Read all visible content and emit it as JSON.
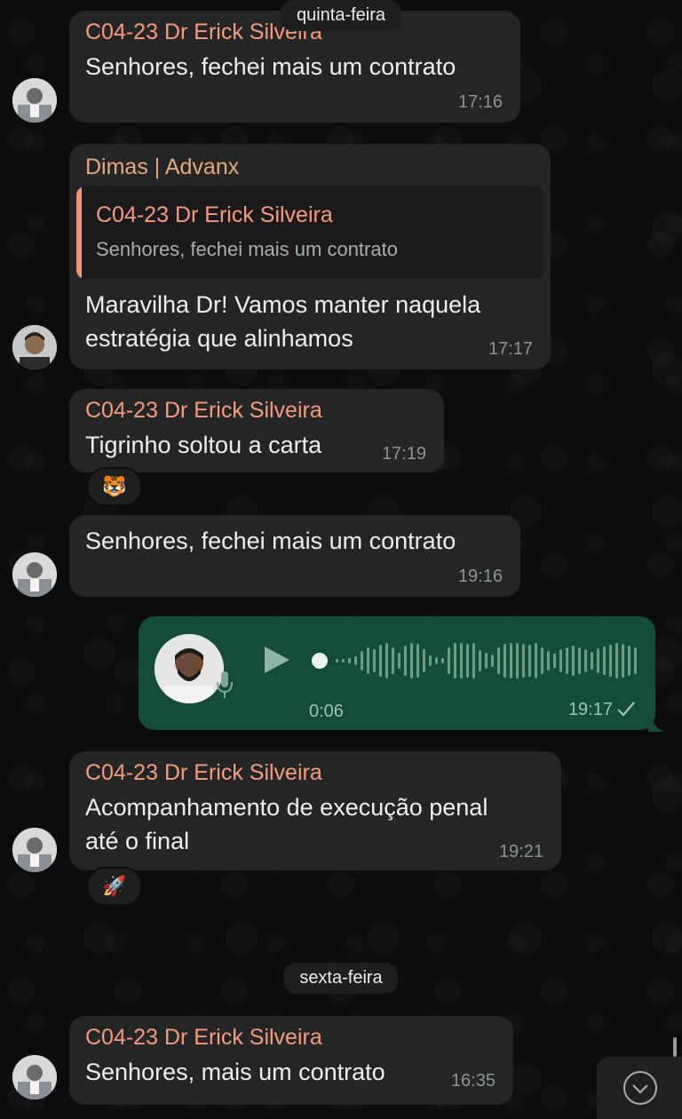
{
  "dates": {
    "first": "quinta-feira",
    "second": "sexta-feira"
  },
  "messages": [
    {
      "sender": "C04-23 Dr Erick Silveira",
      "text": "Senhores, fechei mais um contrato",
      "time": "17:16"
    },
    {
      "sender": "Dimas | Advanx",
      "quote_sender": "C04-23 Dr Erick Silveira",
      "quote_text": "Senhores, fechei mais um contrato",
      "text_line1": "Maravilha Dr! Vamos manter naquela",
      "text_line2": "estratégia que alinhamos",
      "time": "17:17"
    },
    {
      "sender": "C04-23 Dr Erick Silveira",
      "text": "Tigrinho soltou a carta",
      "time": "17:19",
      "reaction": "🐯"
    },
    {
      "text": "Senhores, fechei mais um contrato",
      "time": "19:16"
    },
    {
      "sender": "C04-23 Dr Erick Silveira",
      "text_line1": "Acompanhamento de execução penal",
      "text_line2": "até o final",
      "time": "19:21",
      "reaction": "🚀"
    },
    {
      "sender": "C04-23 Dr Erick Silveira",
      "text": "Senhores, mais um contrato",
      "time": "16:35"
    }
  ],
  "voice_message": {
    "duration": "0:06",
    "time": "19:17",
    "played_fraction": 0.0
  },
  "colors": {
    "sender_name": "#f59b7c",
    "outgoing_bubble": "#144d37",
    "incoming_bubble": "#242626"
  },
  "icons": {
    "play": "play-icon",
    "mic": "mic-icon",
    "check": "check-icon",
    "scroll_down": "chevron-down-icon"
  }
}
